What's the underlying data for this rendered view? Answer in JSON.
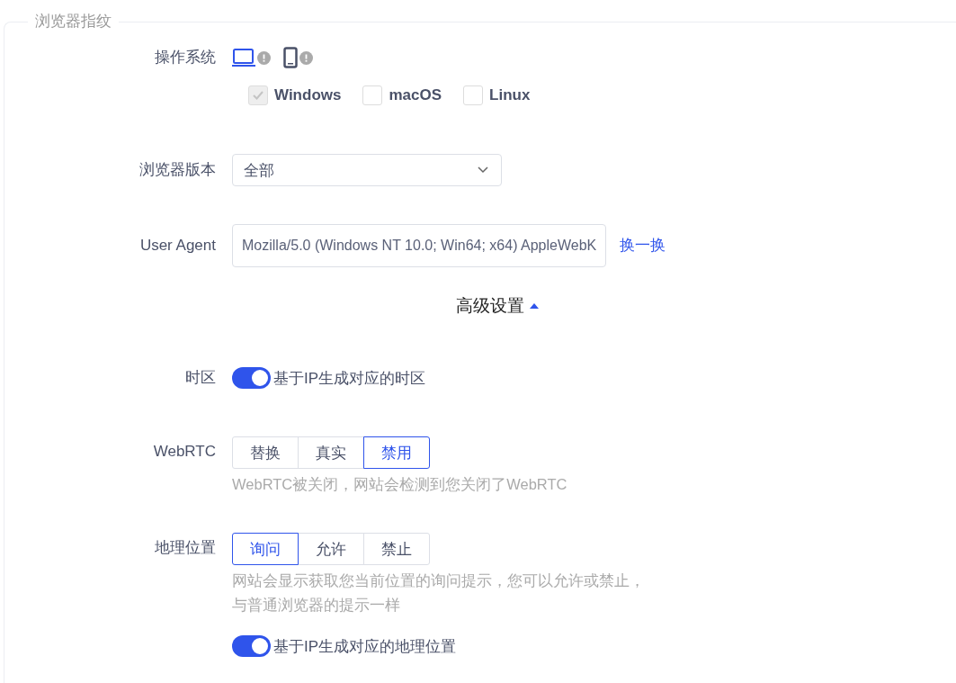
{
  "section": {
    "title": "浏览器指纹"
  },
  "os": {
    "label": "操作系统",
    "devices": [
      {
        "kind": "desktop",
        "selected": true
      },
      {
        "kind": "mobile",
        "selected": false
      }
    ],
    "systems": [
      {
        "label": "Windows",
        "checked": true,
        "disabled": true
      },
      {
        "label": "macOS",
        "checked": false,
        "disabled": false
      },
      {
        "label": "Linux",
        "checked": false,
        "disabled": false
      }
    ]
  },
  "browser_version": {
    "label": "浏览器版本",
    "value": "全部"
  },
  "user_agent": {
    "label": "User Agent",
    "value": "Mozilla/5.0 (Windows NT 10.0; Win64; x64) AppleWebK",
    "action": "换一换"
  },
  "advanced": {
    "label": "高级设置",
    "expanded": true
  },
  "timezone": {
    "label": "时区",
    "on": true,
    "text": "基于IP生成对应的时区"
  },
  "webrtc": {
    "label": "WebRTC",
    "options": [
      {
        "label": "替换",
        "selected": false
      },
      {
        "label": "真实",
        "selected": false
      },
      {
        "label": "禁用",
        "selected": true
      }
    ],
    "hint": "WebRTC被关闭，网站会检测到您关闭了WebRTC"
  },
  "geolocation": {
    "label": "地理位置",
    "options": [
      {
        "label": "询问",
        "selected": true
      },
      {
        "label": "允许",
        "selected": false
      },
      {
        "label": "禁止",
        "selected": false
      }
    ],
    "hint": "网站会显示获取您当前位置的询问提示，您可以允许或禁止，与普通浏览器的提示一样",
    "ip_based": {
      "on": true,
      "text": "基于IP生成对应的地理位置"
    }
  }
}
